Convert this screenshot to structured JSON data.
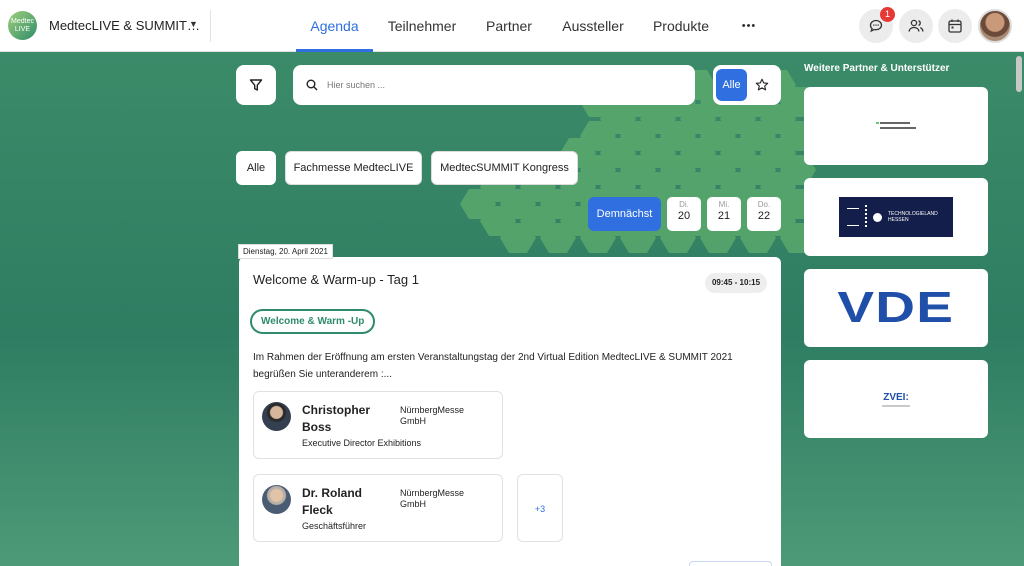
{
  "header": {
    "logo_text_line1": "Medtec",
    "logo_text_line2": "LIVE",
    "event_name": "MedtecLIVE & SUMMIT…",
    "nav": [
      {
        "label": "Agenda",
        "active": true
      },
      {
        "label": "Teilnehmer",
        "active": false
      },
      {
        "label": "Partner",
        "active": false
      },
      {
        "label": "Aussteller",
        "active": false
      },
      {
        "label": "Produkte",
        "active": false
      }
    ],
    "more_label": "•••",
    "chat_badge": "1",
    "icons": [
      "chat-icon",
      "people-icon",
      "calendar-icon",
      "user-avatar"
    ]
  },
  "search": {
    "placeholder": "Hier suchen ...",
    "toggle_all": "Alle"
  },
  "filters": {
    "chips": [
      "Alle",
      "Fachmesse MedtecLIVE",
      "MedtecSUMMIT Kongress"
    ],
    "active": "Alle"
  },
  "dates": {
    "upcoming_label": "Demnächst",
    "days": [
      {
        "weekday": "Di.",
        "day": "20"
      },
      {
        "weekday": "Mi.",
        "day": "21"
      },
      {
        "weekday": "Do.",
        "day": "22"
      }
    ]
  },
  "session": {
    "date_tag": "Dienstag, 20. April 2021",
    "title": "Welcome & Warm-up - Tag 1",
    "time": "09:45 - 10:15",
    "tag": "Welcome & Warm -Up",
    "description": "Im Rahmen der Eröffnung am ersten Veranstaltungstag der 2nd Virtual Edition MedtecLIVE & SUMMIT 2021 begrüßen Sie unteranderem :...",
    "speakers": [
      {
        "name": "Christopher Boss",
        "organization": "NürnbergMesse GmbH",
        "role": "Executive Director Exhibitions"
      },
      {
        "name": "Dr. Roland Fleck",
        "organization": "NürnbergMesse GmbH",
        "role": "Geschäftsführer"
      }
    ],
    "more_speakers": "+3"
  },
  "partners": {
    "heading": "Weitere Partner & Unterstützer",
    "logos": [
      {
        "name": "partner-logo-small",
        "text": ""
      },
      {
        "name": "technologieland-hessen-logo",
        "text": "TECHNOLOGIELAND HESSEN"
      },
      {
        "name": "vde-logo",
        "text": "VDE"
      },
      {
        "name": "zvei-logo",
        "text": "ZVEI:"
      }
    ]
  },
  "colors": {
    "accent": "#2f6fe0",
    "brand_green": "#2e8c6a",
    "badge_red": "#e53935",
    "vde_blue": "#1f4fa8",
    "hessen_navy": "#131e4a"
  }
}
